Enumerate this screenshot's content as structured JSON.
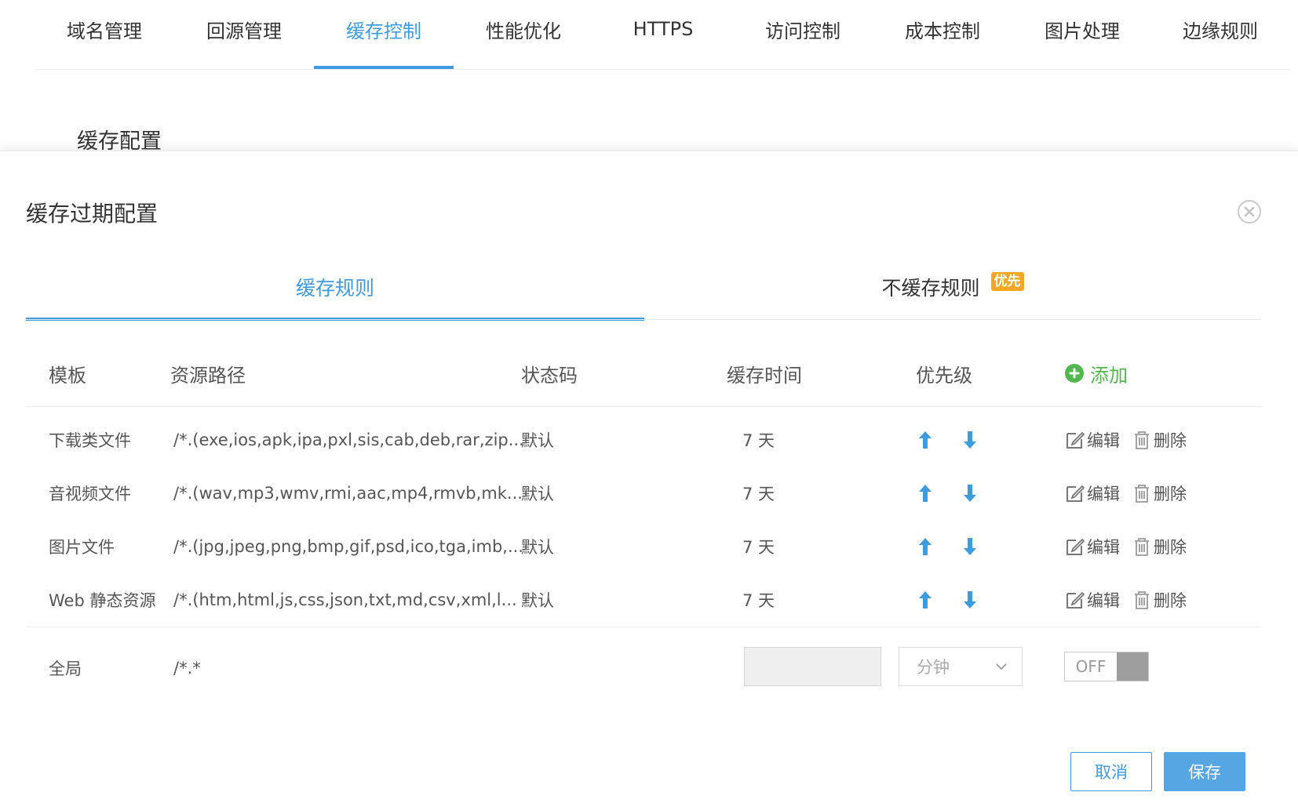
{
  "topnav": {
    "tabs": [
      "域名管理",
      "回源管理",
      "缓存控制",
      "性能优化",
      "HTTPS",
      "访问控制",
      "成本控制",
      "图片处理",
      "边缘规则"
    ],
    "active_index": 2
  },
  "section_title": "缓存配置",
  "modal": {
    "title": "缓存过期配置",
    "subtabs": {
      "cache_rules": "缓存规则",
      "no_cache_rules": "不缓存规则",
      "priority_badge": "优先"
    },
    "table": {
      "headers": {
        "template": "模板",
        "path": "资源路径",
        "status_code": "状态码",
        "cache_time": "缓存时间",
        "priority": "优先级",
        "add": "添加"
      },
      "rows": [
        {
          "template": "下载类文件",
          "path": "/*.(exe,ios,apk,ipa,pxl,sis,cab,deb,rar,zip...",
          "status_code": "默认",
          "cache_time": "7 天",
          "edit": "编辑",
          "delete": "删除"
        },
        {
          "template": "音视频文件",
          "path": "/*.(wav,mp3,wmv,rmi,aac,mp4,rmvb,mk...",
          "status_code": "默认",
          "cache_time": "7 天",
          "edit": "编辑",
          "delete": "删除"
        },
        {
          "template": "图片文件",
          "path": "/*.(jpg,jpeg,png,bmp,gif,psd,ico,tga,imb,...",
          "status_code": "默认",
          "cache_time": "7 天",
          "edit": "编辑",
          "delete": "删除"
        },
        {
          "template": "Web 静态资源",
          "path": "/*.(htm,html,js,css,json,txt,md,csv,xml,l...",
          "status_code": "默认",
          "cache_time": "7 天",
          "edit": "编辑",
          "delete": "删除"
        }
      ],
      "global": {
        "template": "全局",
        "path": "/*.*",
        "time_value": "",
        "unit": "分钟",
        "toggle_label": "OFF"
      }
    },
    "buttons": {
      "cancel": "取消",
      "save": "保存"
    }
  },
  "colors": {
    "accent": "#3d9be0",
    "add_green": "#52b84d",
    "badge_orange": "#f5a623",
    "toggle_off": "#9e9e9e"
  },
  "icons": [
    "close-circle-icon",
    "plus-circle-icon",
    "arrow-up-icon",
    "arrow-down-icon",
    "edit-icon",
    "trash-icon",
    "chevron-down-icon"
  ]
}
